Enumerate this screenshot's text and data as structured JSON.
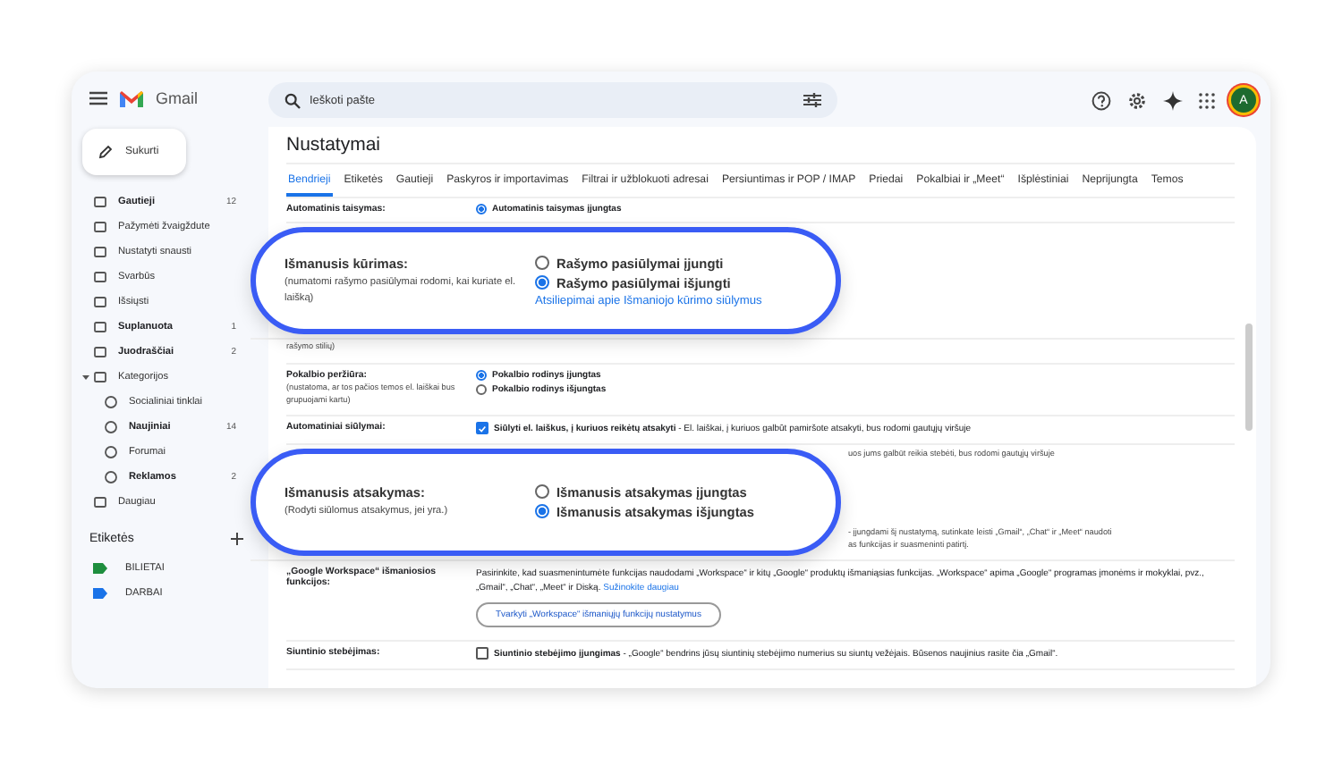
{
  "app": {
    "logo": "Gmail"
  },
  "compose": {
    "label": "Sukurti"
  },
  "nav": [
    {
      "label": "Gautieji",
      "count": "12",
      "bold": true
    },
    {
      "label": "Pažymėti žvaigždute",
      "bold": false
    },
    {
      "label": "Nustatyti snausti",
      "bold": false
    },
    {
      "label": "Svarbūs",
      "bold": false
    },
    {
      "label": "Išsiųsti",
      "bold": false
    },
    {
      "label": "Suplanuota",
      "count": "1",
      "bold": true
    },
    {
      "label": "Juodraščiai",
      "count": "2",
      "bold": true
    },
    {
      "label": "Kategorijos",
      "bold": false,
      "expanded": true,
      "children": [
        {
          "label": "Socialiniai tinklai",
          "bold": false
        },
        {
          "label": "Naujiniai",
          "count": "14",
          "bold": true
        },
        {
          "label": "Forumai",
          "bold": false
        },
        {
          "label": "Reklamos",
          "count": "2",
          "bold": true
        }
      ]
    },
    {
      "label": "Daugiau",
      "bold": false
    }
  ],
  "labels_heading": "Etiketės",
  "labels": [
    {
      "name": "BILIETAI",
      "color": "#1e8e3e"
    },
    {
      "name": "DARBAI",
      "color": "#1a73e8"
    }
  ],
  "search": {
    "placeholder": "Ieškoti pašte"
  },
  "avatar": "A",
  "settings": {
    "title": "Nustatymai",
    "tabs": [
      {
        "label": "Bendrieji",
        "selected": true
      },
      {
        "label": "Etiketės",
        "selected": false
      },
      {
        "label": "Gautieji",
        "selected": false
      },
      {
        "label": "Paskyros ir importavimas",
        "selected": false
      },
      {
        "label": "Filtrai ir užblokuoti adresai",
        "selected": false
      },
      {
        "label": "Persiuntimas ir POP / IMAP",
        "selected": false
      },
      {
        "label": "Priedai",
        "selected": false
      },
      {
        "label": "Pokalbiai ir „Meet“",
        "selected": false
      },
      {
        "label": "Išplėstiniai",
        "selected": false
      },
      {
        "label": "Neprijungta",
        "selected": false
      },
      {
        "label": "Temos",
        "selected": false
      }
    ],
    "rows": [
      {
        "kind": "options",
        "label": "Automatinis taisymas:",
        "options": [
          {
            "label": "Automatinis taisymas įjungtas",
            "selected": true
          }
        ]
      },
      {
        "kind": "callout",
        "label": "Išmanusis kūrimas:",
        "description": "(numatomi rašymo pasiūlymai rodomi, kai kuriate el. laišką)",
        "options": [
          {
            "label": "Rašymo pasiūlymai įjungti",
            "selected": false
          },
          {
            "label": "Rašymo pasiūlymai išjungti",
            "selected": true
          }
        ],
        "link": "Atsiliepimai apie Išmaniojo kūrimo siūlymus"
      },
      {
        "kind": "fragment",
        "label": "rašymo stilių)"
      },
      {
        "kind": "options",
        "label": "Pokalbio peržiūra:",
        "description": "(nustatoma, ar tos pačios temos el. laiškai bus grupuojami kartu)",
        "options": [
          {
            "label": "Pokalbio rodinys įjungtas",
            "selected": true
          },
          {
            "label": "Pokalbio rodinys išjungtas",
            "selected": false
          }
        ]
      },
      {
        "kind": "checkbox",
        "label": "Automatiniai siūlymai:",
        "checked": true,
        "text": "**Siūlyti el. laiškus, į kuriuos reikėtų atsakyti** - El. laiškai, į kuriuos galbūt pamiršote atsakyti, bus rodomi gautųjų viršuje"
      },
      {
        "kind": "callout",
        "label": "Išmanusis atsakymas:",
        "description": "(Rodyti siūlomus atsakymus, jei yra.)",
        "options": [
          {
            "label": "Išmanusis atsakymas įjungtas",
            "selected": false
          },
          {
            "label": "Išmanusis atsakymas išjungtas",
            "selected": true
          }
        ],
        "side_top": [
          "uos jums galbūt reikia stebėti, bus rodomi gautųjų viršuje"
        ],
        "side_bottom": [
          "- įjungdami šį nustatymą, sutinkate leisti „Gmail“, „Chat“ ir „Meet“ naudoti",
          "as funkcijas ir suasmeninti patirtį."
        ]
      },
      {
        "kind": "workspace",
        "label": "„Google Workspace“ išmaniosios funkcijos:",
        "text": "Pasirinkite, kad suasmenintumėte funkcijas naudodami „Workspace“ ir kitų „Google“ produktų išmaniąsias funkcijas. „Workspace“ apima „Google“ programas įmonėms ir mokyklai, pvz., „Gmail“, „Chat“, „Meet“ ir Diską.",
        "link": "Sužinokite daugiau",
        "button": "Tvarkyti „Workspace“ išmaniųjų funkcijų nustatymus"
      },
      {
        "kind": "checkbox",
        "label": "Siuntinio stebėjimas:",
        "checked": false,
        "text": "**Siuntinio stebėjimo įjungimas** - „Google“ bendrins jūsų siuntinių stebėjimo numerius su siuntų vežėjais. Būsenos naujinius rasite čia „Gmail“."
      }
    ]
  }
}
